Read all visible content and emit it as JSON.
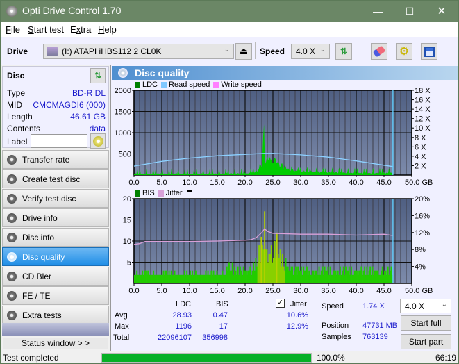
{
  "window": {
    "title": "Opti Drive Control 1.70",
    "minimize_icon": "minimize-icon",
    "maximize_icon": "maximize-icon",
    "close_icon": "close-icon"
  },
  "menu": [
    "File",
    "Start test",
    "Extra",
    "Help"
  ],
  "toolbar": {
    "drive_label": "Drive",
    "drive_value": "(I:)  ATAPI iHBS112   2 CL0K",
    "speed_label": "Speed",
    "speed_value": "4.0 X",
    "icons": [
      "eject-icon",
      "refresh-icon",
      "eraser-icon",
      "settings-icon",
      "save-icon"
    ]
  },
  "disc": {
    "header": "Disc",
    "type_label": "Type",
    "type_value": "BD-R DL",
    "mid_label": "MID",
    "mid_value": "CMCMAGDI6 (000)",
    "length_label": "Length",
    "length_value": "46.61 GB",
    "contents_label": "Contents",
    "contents_value": "data",
    "label_label": "Label",
    "label_value": ""
  },
  "nav": [
    {
      "label": "Transfer rate",
      "active": false
    },
    {
      "label": "Create test disc",
      "active": false
    },
    {
      "label": "Verify test disc",
      "active": false
    },
    {
      "label": "Drive info",
      "active": false
    },
    {
      "label": "Disc info",
      "active": false
    },
    {
      "label": "Disc quality",
      "active": true
    },
    {
      "label": "CD Bler",
      "active": false
    },
    {
      "label": "FE / TE",
      "active": false
    },
    {
      "label": "Extra tests",
      "active": false
    }
  ],
  "status_window_label": "Status window > >",
  "panel_title": "Disc quality",
  "chart_data": [
    {
      "type": "area",
      "title": "LDC / Read speed",
      "legend": [
        {
          "name": "LDC",
          "color": "#008000"
        },
        {
          "name": "Read speed",
          "color": "#80c8ff"
        },
        {
          "name": "Write speed",
          "color": "#ff80ff"
        }
      ],
      "xlim": [
        0,
        50
      ],
      "ylim": [
        0,
        2000
      ],
      "y2lim": [
        0,
        18
      ],
      "xticks": [
        "0.0",
        "5.0",
        "10.0",
        "15.0",
        "20.0",
        "25.0",
        "30.0",
        "35.0",
        "40.0",
        "45.0",
        "50.0 GB"
      ],
      "yticks": [
        "500",
        "1000",
        "1500",
        "2000"
      ],
      "y2ticks": [
        "2 X",
        "4 X",
        "6 X",
        "8 X",
        "10 X",
        "12 X",
        "14 X",
        "16 X",
        "18 X"
      ],
      "end_marker_gb": 46.61,
      "ldc_x": [
        0,
        1,
        2,
        3,
        4,
        5,
        6,
        7,
        8,
        9,
        10,
        11,
        12,
        13,
        14,
        15,
        16,
        17,
        18,
        19,
        20,
        21,
        22,
        22.5,
        23,
        23.4,
        23.6,
        24,
        24.5,
        25,
        25.5,
        26,
        27,
        28,
        29,
        30,
        31,
        32,
        33,
        34,
        35,
        36,
        37,
        38,
        39,
        40,
        41,
        42,
        43,
        44,
        45,
        46,
        46.6
      ],
      "ldc_y": [
        40,
        45,
        35,
        40,
        40,
        45,
        35,
        40,
        45,
        40,
        35,
        40,
        40,
        40,
        45,
        40,
        45,
        50,
        45,
        45,
        50,
        60,
        100,
        180,
        300,
        1196,
        330,
        420,
        440,
        430,
        400,
        320,
        200,
        150,
        120,
        110,
        100,
        95,
        90,
        85,
        80,
        75,
        70,
        65,
        60,
        60,
        55,
        55,
        55,
        55,
        60,
        60,
        55
      ],
      "read_speed_x": [
        0,
        5,
        10,
        15,
        20,
        23.5,
        25,
        30,
        35,
        40,
        45,
        46.6
      ],
      "read_speed_y": [
        1.9,
        2.9,
        3.6,
        4.1,
        4.4,
        4.6,
        4.6,
        4.3,
        3.8,
        3.0,
        2.1,
        1.8
      ]
    },
    {
      "type": "area",
      "title": "BIS / Jitter",
      "legend": [
        {
          "name": "BIS",
          "color": "#008000"
        },
        {
          "name": "Jitter",
          "color": "#d8a0d8"
        }
      ],
      "xlim": [
        0,
        50
      ],
      "ylim": [
        0,
        20
      ],
      "y2lim": [
        0,
        20
      ],
      "xticks": [
        "0.0",
        "5.0",
        "10.0",
        "15.0",
        "20.0",
        "25.0",
        "30.0",
        "35.0",
        "40.0",
        "45.0",
        "50.0 GB"
      ],
      "yticks": [
        "5",
        "10",
        "15",
        "20"
      ],
      "y2ticks": [
        "4%",
        "8%",
        "12%",
        "16%",
        "20%"
      ],
      "end_marker_gb": 46.61,
      "bis_x": [
        0,
        2,
        4,
        6,
        8,
        10,
        12,
        14,
        16,
        17,
        18,
        20,
        21,
        22,
        22.5,
        23,
        23.3,
        23.6,
        24,
        24.5,
        25,
        25.5,
        26,
        27,
        28,
        30,
        32,
        34,
        36,
        38,
        40,
        42,
        44,
        46,
        46.6
      ],
      "bis_y": [
        3,
        3,
        3,
        3,
        3,
        3,
        3,
        3,
        3,
        5,
        4,
        4,
        4,
        6,
        9,
        13,
        17,
        12,
        10,
        10,
        9,
        12,
        8,
        6,
        5,
        4,
        4,
        4,
        4,
        4,
        4,
        4,
        4,
        4,
        5
      ],
      "jitter_x": [
        0,
        1,
        2,
        5,
        10,
        15,
        20,
        21,
        22,
        23,
        23.5,
        24,
        25,
        30,
        35,
        40,
        45,
        46.6
      ],
      "jitter_y": [
        9.2,
        9.4,
        9.9,
        9.9,
        9.9,
        10.0,
        10.2,
        10.3,
        10.8,
        12.0,
        12.9,
        12.3,
        11.8,
        11.6,
        11.6,
        11.4,
        11.6,
        11.3
      ]
    }
  ],
  "stats": {
    "col_ldc": "LDC",
    "col_bis": "BIS",
    "jitter_label": "Jitter",
    "jitter_checked": true,
    "avg_label": "Avg",
    "max_label": "Max",
    "total_label": "Total",
    "ldc_avg": "28.93",
    "ldc_max": "1196",
    "ldc_total": "22096107",
    "bis_avg": "0.47",
    "bis_max": "17",
    "bis_total": "356998",
    "jitter_avg": "10.6%",
    "jitter_max": "12.9%",
    "speed_label": "Speed",
    "speed_value": "1.74 X",
    "position_label": "Position",
    "position_value": "47731 MB",
    "samples_label": "Samples",
    "samples_value": "763139",
    "speed_select": "4.0 X",
    "start_full": "Start full",
    "start_part": "Start part"
  },
  "statusbar": {
    "text": "Test completed",
    "progress": 100.0,
    "progress_text": "100.0%",
    "time": "66:19"
  }
}
